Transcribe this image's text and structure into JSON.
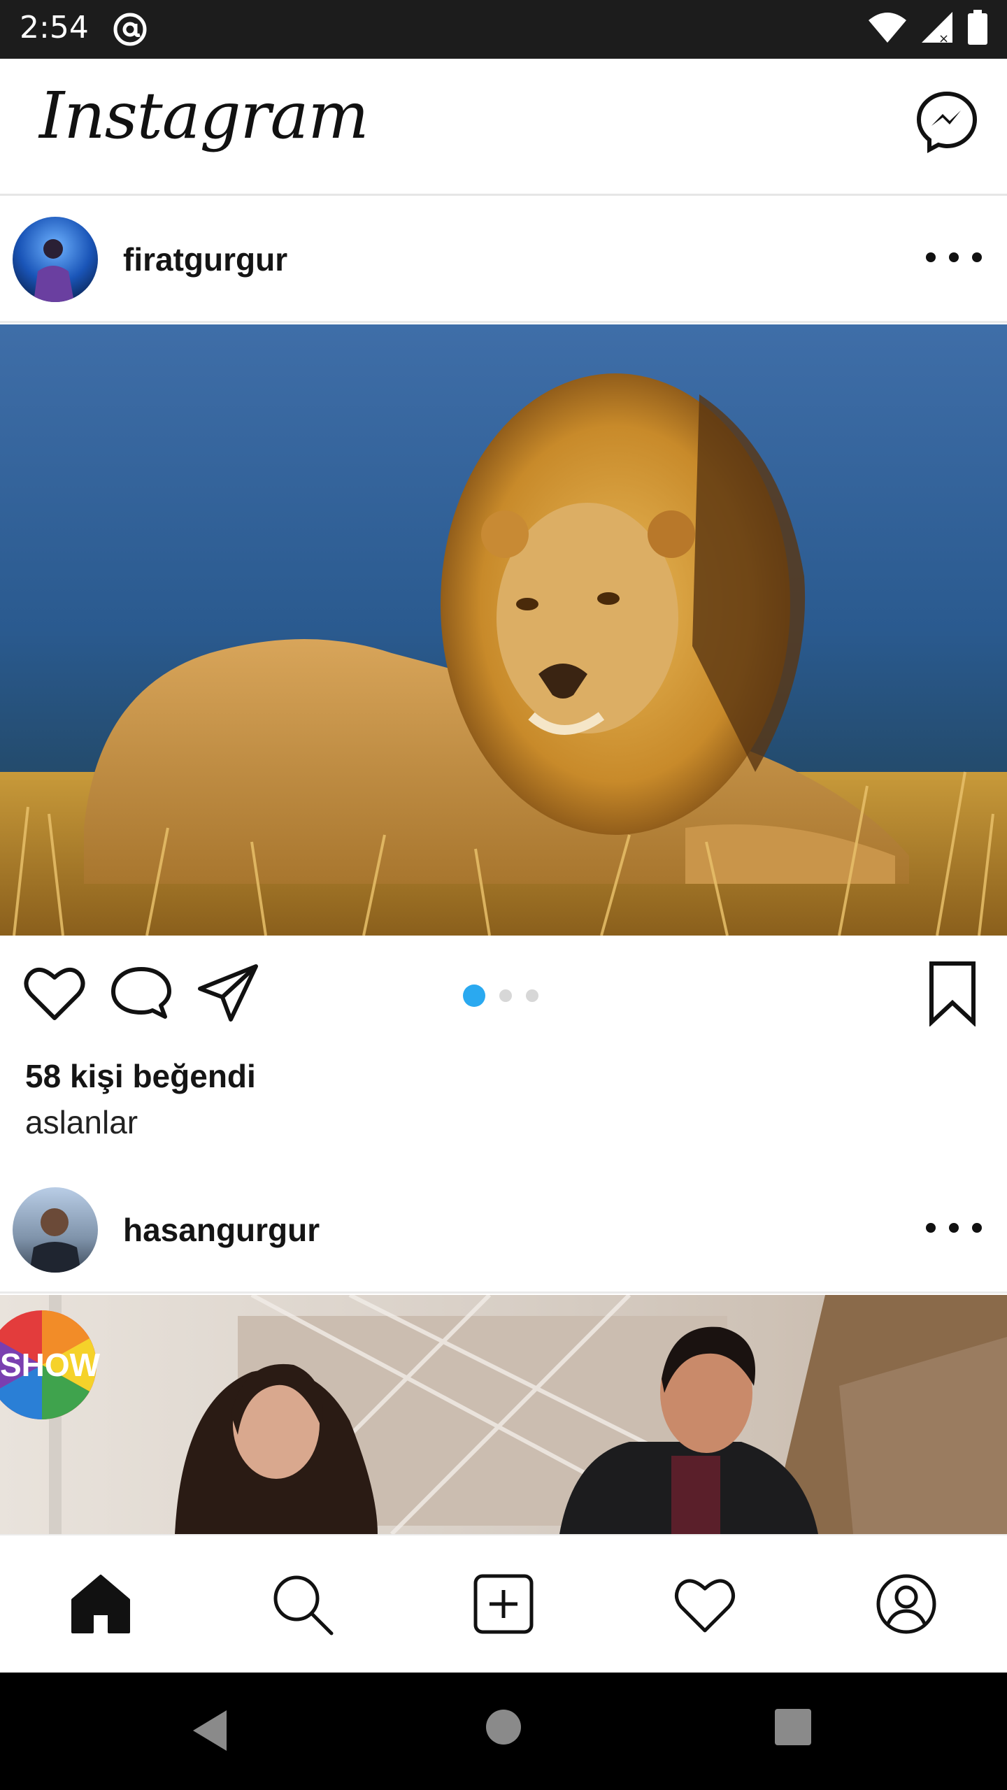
{
  "status_bar": {
    "time": "2:54"
  },
  "app": {
    "brand": "Instagram"
  },
  "feed": {
    "posts": [
      {
        "username": "firatgurgur",
        "likes": "58 kişi beğendi",
        "caption": "aslanlar",
        "carousel": {
          "count": 3,
          "active_index": 0
        }
      },
      {
        "username": "hasangurgur",
        "image_text": "SHOW"
      }
    ]
  },
  "colors": {
    "accent": "#2aa9f0",
    "status_bar_bg": "#1c1c1c",
    "system_nav_bg": "#000000"
  },
  "icons": {
    "post_actions": [
      "heart-icon",
      "comment-icon",
      "share-icon",
      "bookmark-icon"
    ],
    "bottom_nav": [
      "home-icon",
      "search-icon",
      "add-post-icon",
      "activity-heart-icon",
      "profile-icon"
    ]
  }
}
